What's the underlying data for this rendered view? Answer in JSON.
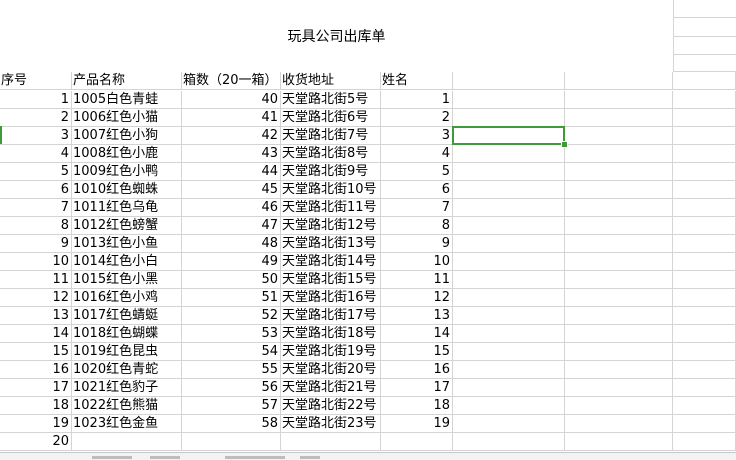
{
  "sheet": {
    "title": "玩具公司出库单",
    "headers": {
      "seq": "序号",
      "product": "产品名称",
      "boxes": "箱数（20一箱）",
      "address": "收货地址",
      "name": "姓名"
    },
    "rows": [
      {
        "seq": "1",
        "product": "1005白色青蛙",
        "boxes": "40",
        "address": "天堂路北街5号",
        "name": "1"
      },
      {
        "seq": "2",
        "product": "1006红色小猫",
        "boxes": "41",
        "address": "天堂路北街6号",
        "name": "2"
      },
      {
        "seq": "3",
        "product": "1007红色小狗",
        "boxes": "42",
        "address": "天堂路北街7号",
        "name": "3"
      },
      {
        "seq": "4",
        "product": "1008红色小鹿",
        "boxes": "43",
        "address": "天堂路北街8号",
        "name": "4"
      },
      {
        "seq": "5",
        "product": "1009红色小鸭",
        "boxes": "44",
        "address": "天堂路北街9号",
        "name": "5"
      },
      {
        "seq": "6",
        "product": "1010红色蜘蛛",
        "boxes": "45",
        "address": "天堂路北街10号",
        "name": "6"
      },
      {
        "seq": "7",
        "product": "1011红色乌龟",
        "boxes": "46",
        "address": "天堂路北街11号",
        "name": "7"
      },
      {
        "seq": "8",
        "product": "1012红色螃蟹",
        "boxes": "47",
        "address": "天堂路北街12号",
        "name": "8"
      },
      {
        "seq": "9",
        "product": "1013红色小鱼",
        "boxes": "48",
        "address": "天堂路北街13号",
        "name": "9"
      },
      {
        "seq": "10",
        "product": "1014红色小白",
        "boxes": "49",
        "address": "天堂路北街14号",
        "name": "10"
      },
      {
        "seq": "11",
        "product": "1015红色小黑",
        "boxes": "50",
        "address": "天堂路北街15号",
        "name": "11"
      },
      {
        "seq": "12",
        "product": "1016红色小鸡",
        "boxes": "51",
        "address": "天堂路北街16号",
        "name": "12"
      },
      {
        "seq": "13",
        "product": "1017红色蜻蜓",
        "boxes": "52",
        "address": "天堂路北街17号",
        "name": "13"
      },
      {
        "seq": "14",
        "product": "1018红色蝴蝶",
        "boxes": "53",
        "address": "天堂路北街18号",
        "name": "14"
      },
      {
        "seq": "15",
        "product": "1019红色昆虫",
        "boxes": "54",
        "address": "天堂路北街19号",
        "name": "15"
      },
      {
        "seq": "16",
        "product": "1020红色青蛇",
        "boxes": "55",
        "address": "天堂路北街20号",
        "name": "16"
      },
      {
        "seq": "17",
        "product": "1021红色豹子",
        "boxes": "56",
        "address": "天堂路北街21号",
        "name": "17"
      },
      {
        "seq": "18",
        "product": "1022红色熊猫",
        "boxes": "57",
        "address": "天堂路北街22号",
        "name": "18"
      },
      {
        "seq": "19",
        "product": "1023红色金鱼",
        "boxes": "58",
        "address": "天堂路北街23号",
        "name": "19"
      },
      {
        "seq": "20",
        "product": "",
        "boxes": "",
        "address": "",
        "name": ""
      }
    ],
    "selection_color": "#3f9b3a",
    "gridline_color": "#d4d4d4"
  }
}
